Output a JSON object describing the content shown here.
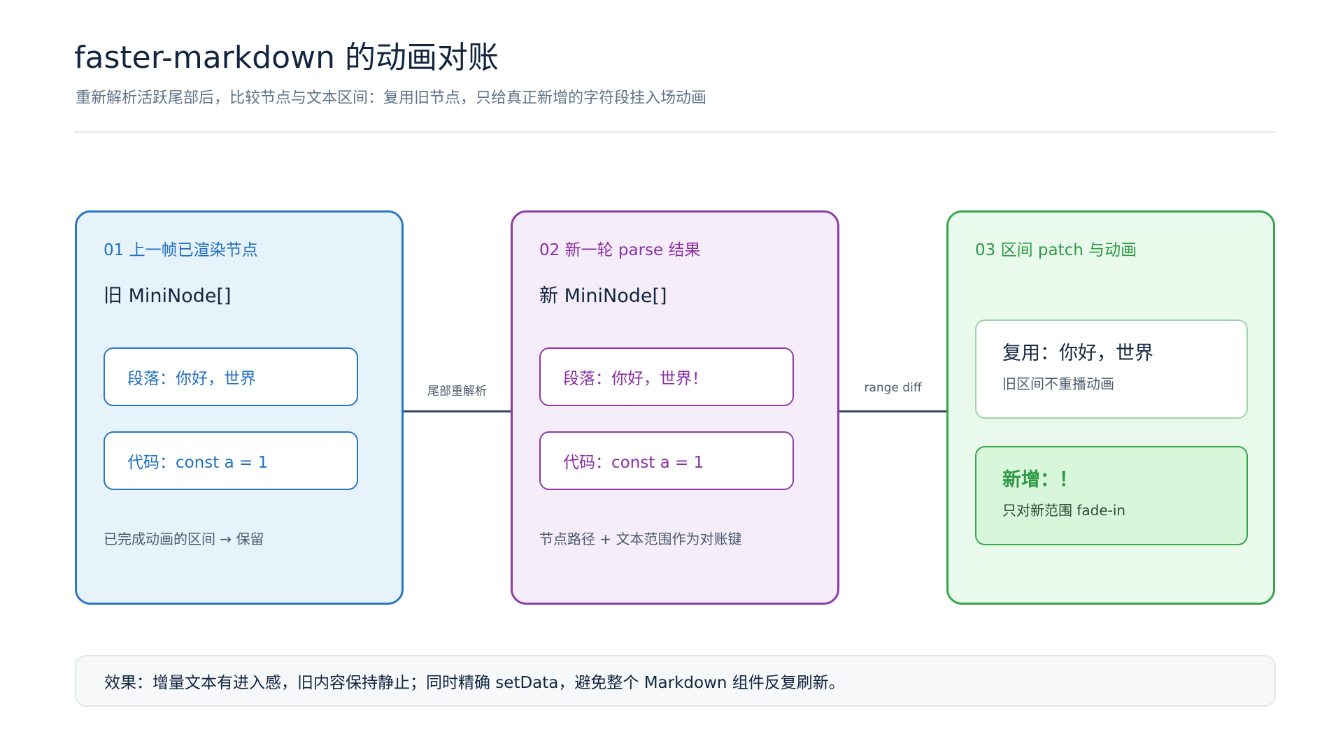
{
  "header": {
    "title": "faster-markdown 的动画对账",
    "subtitle": "重新解析活跃尾部后，比较节点与文本区间：复用旧节点，只给真正新增的字符段挂入场动画"
  },
  "panels": [
    {
      "heading": "01  上一帧已渲染节点",
      "node_title": "旧 MiniNode[]",
      "boxes": [
        "段落：你好，世界",
        "代码：const a = 1"
      ],
      "note": "已完成动画的区间 → 保留"
    },
    {
      "heading": "02  新一轮 parse 结果",
      "node_title": "新 MiniNode[]",
      "boxes": [
        "段落：你好，世界！",
        "代码：const a = 1"
      ],
      "note": "节点路径 + 文本范围作为对账键"
    },
    {
      "heading": "03  区间 patch 与动画",
      "cards": [
        {
          "title": "复用：你好，世界",
          "desc": "旧区间不重播动画"
        },
        {
          "title": "新增：！",
          "desc": "只对新范围 fade-in"
        }
      ]
    }
  ],
  "connectors": [
    {
      "label": "尾部重解析"
    },
    {
      "label": "range diff"
    }
  ],
  "footer": {
    "text": "效果：增量文本有进入感，旧内容保持静止；同时精确 setData，避免整个 Markdown 组件反复刷新。"
  },
  "colors": {
    "panel_1_border": "#2a77c2",
    "panel_2_border": "#8c3ca7",
    "panel_3_border": "#36a64d",
    "connector": "#34495e"
  }
}
